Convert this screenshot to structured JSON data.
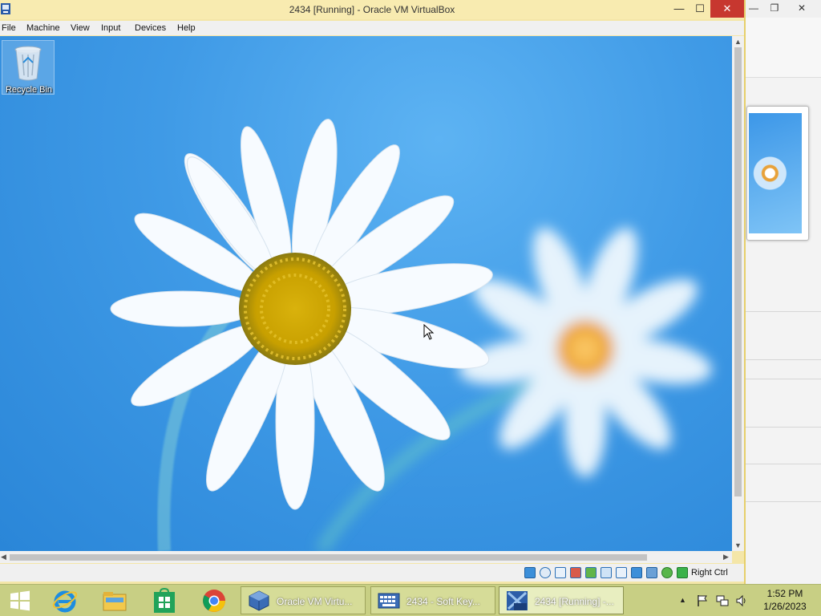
{
  "vm_window": {
    "title": "2434 [Running] - Oracle VM VirtualBox",
    "controls": {
      "minimize": "—",
      "maximize": "☐",
      "close": "✕"
    },
    "menu": [
      "File",
      "Machine",
      "View",
      "Input",
      "Devices",
      "Help"
    ],
    "status_bar": {
      "host_key": "Right Ctrl"
    }
  },
  "guest_desktop": {
    "icons": [
      {
        "label": "Recycle Bin"
      }
    ]
  },
  "host_window": {
    "controls": {
      "minimize": "—",
      "restore": "❐",
      "close": "✕"
    }
  },
  "taskbar": {
    "tasks": [
      {
        "label": "Oracle VM Virtu..."
      },
      {
        "label": "2434 - Soft Key..."
      },
      {
        "label": "2434 [Running] -..."
      }
    ],
    "clock": {
      "time": "1:52 PM",
      "date": "1/26/2023"
    }
  },
  "colors": {
    "title_bar": "#f8ebb0",
    "close_button": "#c7372f",
    "taskbar": "#c8cf84",
    "desktop_sky": "#3f9ae6"
  }
}
